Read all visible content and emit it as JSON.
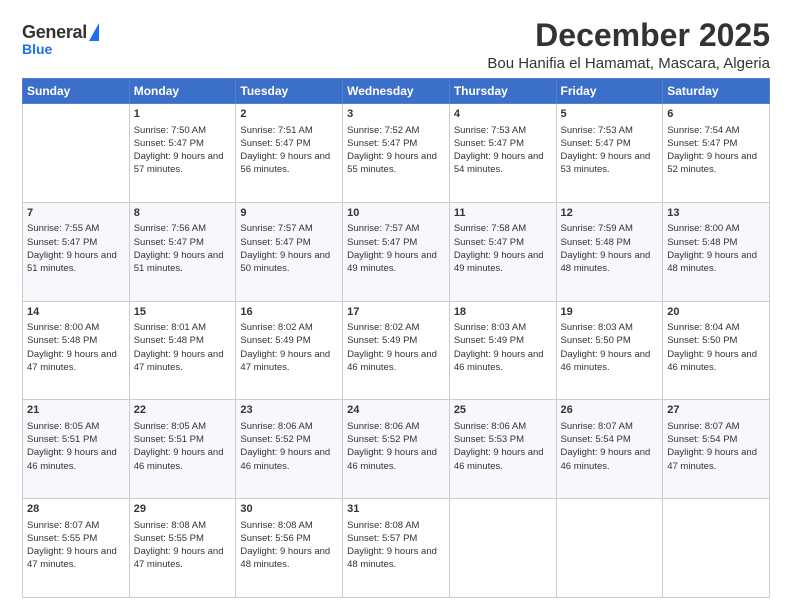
{
  "logo": {
    "general": "General",
    "blue": "Blue"
  },
  "header": {
    "month": "December 2025",
    "location": "Bou Hanifia el Hamamat, Mascara, Algeria"
  },
  "days": [
    "Sunday",
    "Monday",
    "Tuesday",
    "Wednesday",
    "Thursday",
    "Friday",
    "Saturday"
  ],
  "weeks": [
    [
      {
        "day": "",
        "sunrise": "",
        "sunset": "",
        "daylight": ""
      },
      {
        "day": "1",
        "sunrise": "Sunrise: 7:50 AM",
        "sunset": "Sunset: 5:47 PM",
        "daylight": "Daylight: 9 hours and 57 minutes."
      },
      {
        "day": "2",
        "sunrise": "Sunrise: 7:51 AM",
        "sunset": "Sunset: 5:47 PM",
        "daylight": "Daylight: 9 hours and 56 minutes."
      },
      {
        "day": "3",
        "sunrise": "Sunrise: 7:52 AM",
        "sunset": "Sunset: 5:47 PM",
        "daylight": "Daylight: 9 hours and 55 minutes."
      },
      {
        "day": "4",
        "sunrise": "Sunrise: 7:53 AM",
        "sunset": "Sunset: 5:47 PM",
        "daylight": "Daylight: 9 hours and 54 minutes."
      },
      {
        "day": "5",
        "sunrise": "Sunrise: 7:53 AM",
        "sunset": "Sunset: 5:47 PM",
        "daylight": "Daylight: 9 hours and 53 minutes."
      },
      {
        "day": "6",
        "sunrise": "Sunrise: 7:54 AM",
        "sunset": "Sunset: 5:47 PM",
        "daylight": "Daylight: 9 hours and 52 minutes."
      }
    ],
    [
      {
        "day": "7",
        "sunrise": "Sunrise: 7:55 AM",
        "sunset": "Sunset: 5:47 PM",
        "daylight": "Daylight: 9 hours and 51 minutes."
      },
      {
        "day": "8",
        "sunrise": "Sunrise: 7:56 AM",
        "sunset": "Sunset: 5:47 PM",
        "daylight": "Daylight: 9 hours and 51 minutes."
      },
      {
        "day": "9",
        "sunrise": "Sunrise: 7:57 AM",
        "sunset": "Sunset: 5:47 PM",
        "daylight": "Daylight: 9 hours and 50 minutes."
      },
      {
        "day": "10",
        "sunrise": "Sunrise: 7:57 AM",
        "sunset": "Sunset: 5:47 PM",
        "daylight": "Daylight: 9 hours and 49 minutes."
      },
      {
        "day": "11",
        "sunrise": "Sunrise: 7:58 AM",
        "sunset": "Sunset: 5:47 PM",
        "daylight": "Daylight: 9 hours and 49 minutes."
      },
      {
        "day": "12",
        "sunrise": "Sunrise: 7:59 AM",
        "sunset": "Sunset: 5:48 PM",
        "daylight": "Daylight: 9 hours and 48 minutes."
      },
      {
        "day": "13",
        "sunrise": "Sunrise: 8:00 AM",
        "sunset": "Sunset: 5:48 PM",
        "daylight": "Daylight: 9 hours and 48 minutes."
      }
    ],
    [
      {
        "day": "14",
        "sunrise": "Sunrise: 8:00 AM",
        "sunset": "Sunset: 5:48 PM",
        "daylight": "Daylight: 9 hours and 47 minutes."
      },
      {
        "day": "15",
        "sunrise": "Sunrise: 8:01 AM",
        "sunset": "Sunset: 5:48 PM",
        "daylight": "Daylight: 9 hours and 47 minutes."
      },
      {
        "day": "16",
        "sunrise": "Sunrise: 8:02 AM",
        "sunset": "Sunset: 5:49 PM",
        "daylight": "Daylight: 9 hours and 47 minutes."
      },
      {
        "day": "17",
        "sunrise": "Sunrise: 8:02 AM",
        "sunset": "Sunset: 5:49 PM",
        "daylight": "Daylight: 9 hours and 46 minutes."
      },
      {
        "day": "18",
        "sunrise": "Sunrise: 8:03 AM",
        "sunset": "Sunset: 5:49 PM",
        "daylight": "Daylight: 9 hours and 46 minutes."
      },
      {
        "day": "19",
        "sunrise": "Sunrise: 8:03 AM",
        "sunset": "Sunset: 5:50 PM",
        "daylight": "Daylight: 9 hours and 46 minutes."
      },
      {
        "day": "20",
        "sunrise": "Sunrise: 8:04 AM",
        "sunset": "Sunset: 5:50 PM",
        "daylight": "Daylight: 9 hours and 46 minutes."
      }
    ],
    [
      {
        "day": "21",
        "sunrise": "Sunrise: 8:05 AM",
        "sunset": "Sunset: 5:51 PM",
        "daylight": "Daylight: 9 hours and 46 minutes."
      },
      {
        "day": "22",
        "sunrise": "Sunrise: 8:05 AM",
        "sunset": "Sunset: 5:51 PM",
        "daylight": "Daylight: 9 hours and 46 minutes."
      },
      {
        "day": "23",
        "sunrise": "Sunrise: 8:06 AM",
        "sunset": "Sunset: 5:52 PM",
        "daylight": "Daylight: 9 hours and 46 minutes."
      },
      {
        "day": "24",
        "sunrise": "Sunrise: 8:06 AM",
        "sunset": "Sunset: 5:52 PM",
        "daylight": "Daylight: 9 hours and 46 minutes."
      },
      {
        "day": "25",
        "sunrise": "Sunrise: 8:06 AM",
        "sunset": "Sunset: 5:53 PM",
        "daylight": "Daylight: 9 hours and 46 minutes."
      },
      {
        "day": "26",
        "sunrise": "Sunrise: 8:07 AM",
        "sunset": "Sunset: 5:54 PM",
        "daylight": "Daylight: 9 hours and 46 minutes."
      },
      {
        "day": "27",
        "sunrise": "Sunrise: 8:07 AM",
        "sunset": "Sunset: 5:54 PM",
        "daylight": "Daylight: 9 hours and 47 minutes."
      }
    ],
    [
      {
        "day": "28",
        "sunrise": "Sunrise: 8:07 AM",
        "sunset": "Sunset: 5:55 PM",
        "daylight": "Daylight: 9 hours and 47 minutes."
      },
      {
        "day": "29",
        "sunrise": "Sunrise: 8:08 AM",
        "sunset": "Sunset: 5:55 PM",
        "daylight": "Daylight: 9 hours and 47 minutes."
      },
      {
        "day": "30",
        "sunrise": "Sunrise: 8:08 AM",
        "sunset": "Sunset: 5:56 PM",
        "daylight": "Daylight: 9 hours and 48 minutes."
      },
      {
        "day": "31",
        "sunrise": "Sunrise: 8:08 AM",
        "sunset": "Sunset: 5:57 PM",
        "daylight": "Daylight: 9 hours and 48 minutes."
      },
      {
        "day": "",
        "sunrise": "",
        "sunset": "",
        "daylight": ""
      },
      {
        "day": "",
        "sunrise": "",
        "sunset": "",
        "daylight": ""
      },
      {
        "day": "",
        "sunrise": "",
        "sunset": "",
        "daylight": ""
      }
    ]
  ]
}
